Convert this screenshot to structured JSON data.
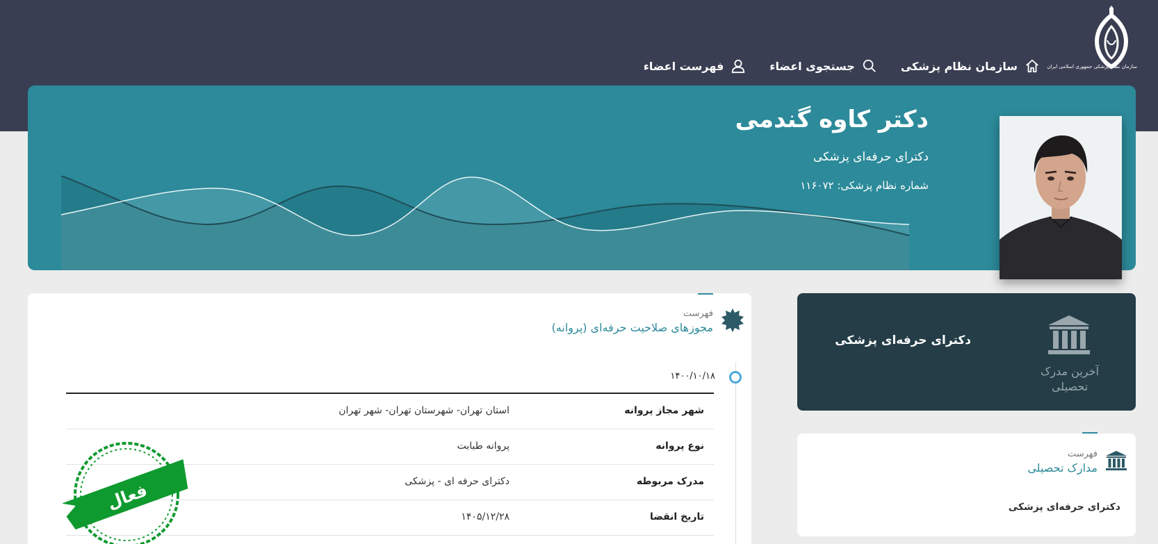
{
  "logo": {
    "text": "سازمان نظام پزشکی جمهوری اسلامی ایران"
  },
  "nav": {
    "home": "سازمان نظام پزشکی",
    "search": "جستجوی اعضاء",
    "members": "فهرست اعضاء"
  },
  "profile": {
    "name": "دکتر کاوه گندمی",
    "degree": "دکترای حرفه‌ای پزشکی",
    "number_line": "شماره نظام پزشکی: ۱۱۶۰۷۲"
  },
  "latest_degree": {
    "title": "دکترای حرفه‌ای پزشکی",
    "label": "آخرین مدرک تحصیلی"
  },
  "education": {
    "pre": "فهرست",
    "title": "مدارک تحصیلی",
    "items": [
      "دکترای حرفه‌ای پزشکی"
    ]
  },
  "licenses": {
    "pre": "فهرست",
    "title": "مجوزهای صلاحیت حرفه‌ای (پروانه)",
    "date": "۱۴۰۰/۱۰/۱۸",
    "rows": [
      {
        "k": "شهر مجاز پروانه",
        "v": "استان تهران- شهرستان تهران- شهر تهران"
      },
      {
        "k": "نوع پروانه",
        "v": "پروانه طبابت"
      },
      {
        "k": "مدرک مربوطه",
        "v": "دکترای حرفه ای - پزشکی"
      },
      {
        "k": "تاریخ انقضا",
        "v": "۱۴۰۵/۱۲/۲۸"
      }
    ],
    "status_stamp": "فعال"
  },
  "colors": {
    "teal": "#2c8a9a",
    "dark": "#3a3e52",
    "card_dark": "#243d47",
    "stamp_green": "#0f9a2f"
  }
}
